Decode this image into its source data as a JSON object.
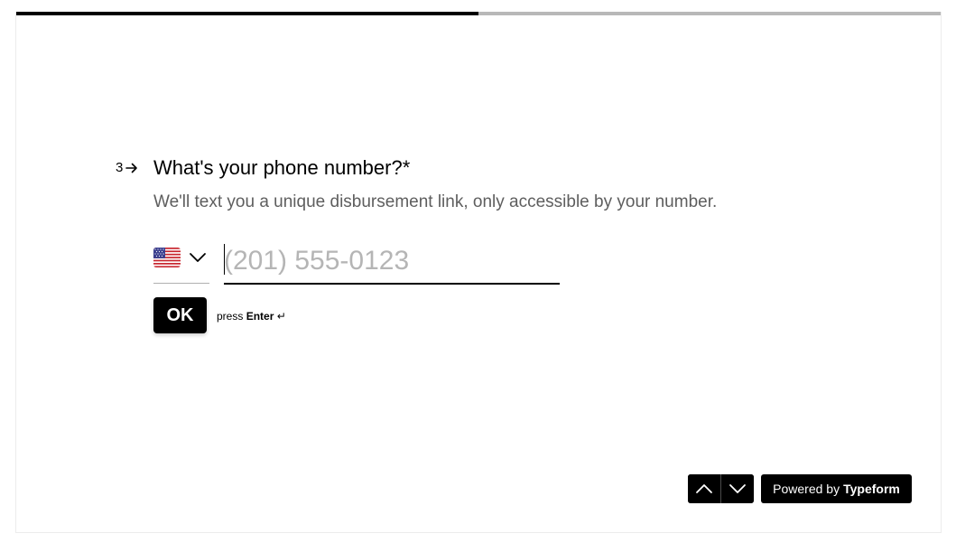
{
  "progress": {
    "fraction": 0.5
  },
  "question": {
    "number": "3",
    "number_icon": "arrow-right-icon",
    "title": "What's your phone number?*",
    "description": "We'll text you a unique disbursement link, only accessible by your number."
  },
  "phone": {
    "country_flag_icon": "us-flag-icon",
    "value": "",
    "placeholder": "(201) 555-0123"
  },
  "submit": {
    "ok_label": "OK",
    "hint_prefix": "press",
    "hint_key": "Enter",
    "hint_icon": "return-icon",
    "hint_glyph": "↵"
  },
  "footer": {
    "prev_icon": "chevron-up-icon",
    "next_icon": "chevron-down-icon",
    "powered_prefix": "Powered by",
    "powered_brand": "Typeform"
  }
}
